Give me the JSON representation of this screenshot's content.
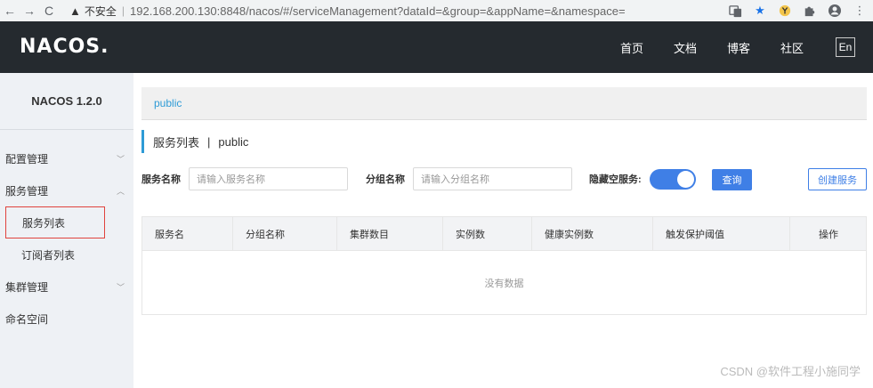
{
  "browser": {
    "back": "←",
    "forward": "→",
    "reload": "C",
    "warning_icon": "▲",
    "warning_text": "不安全",
    "url": "192.168.200.130:8848/nacos/#/serviceManagement?dataId=&group=&appName=&namespace=",
    "icons": [
      "translate-icon",
      "star-icon",
      "extension-y-icon",
      "puzzle-icon",
      "account-icon",
      "more-icon"
    ]
  },
  "header": {
    "logo": "NACOS.",
    "nav": [
      "首页",
      "文档",
      "博客",
      "社区"
    ],
    "lang": "En"
  },
  "sidebar": {
    "title": "NACOS 1.2.0",
    "items": {
      "config": "配置管理",
      "service": "服务管理",
      "service_list": "服务列表",
      "subscriber_list": "订阅者列表",
      "cluster": "集群管理",
      "namespace": "命名空间"
    }
  },
  "main": {
    "breadcrumb": "public",
    "title": "服务列表",
    "title_sep": "|",
    "title_ns": "public",
    "form": {
      "service_name_label": "服务名称",
      "service_name_placeholder": "请输入服务名称",
      "group_name_label": "分组名称",
      "group_name_placeholder": "请输入分组名称",
      "hide_empty_label": "隐藏空服务:",
      "hide_empty_on": true,
      "query_button": "查询",
      "create_button": "创建服务"
    },
    "table": {
      "columns": [
        "服务名",
        "分组名称",
        "集群数目",
        "实例数",
        "健康实例数",
        "触发保护阈值",
        "操作"
      ],
      "empty_text": "没有数据"
    }
  },
  "watermark": "CSDN @软件工程小施同学",
  "colors": {
    "header_bg": "#252a2f",
    "accent": "#3f7fe6",
    "link": "#2e9bd6",
    "highlight_border": "#e0433d"
  }
}
